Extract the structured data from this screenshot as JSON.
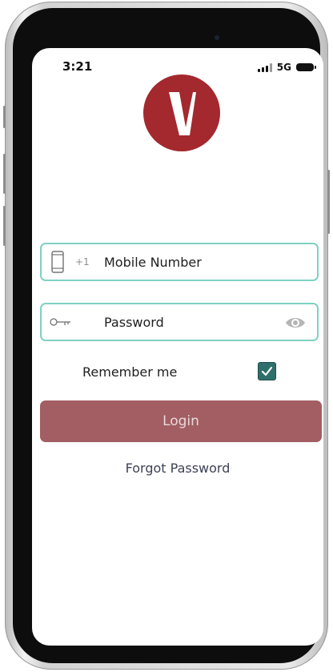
{
  "status_bar": {
    "time": "3:21",
    "network": "5G",
    "icons": [
      "signal-icon",
      "battery-icon"
    ]
  },
  "logo": {
    "icon": "brand-logo-icon",
    "colors": {
      "background": "#a3292e",
      "mark": "#ffffff"
    }
  },
  "login_form": {
    "mobile": {
      "icon": "phone-icon",
      "prefix": "+1",
      "placeholder": "Mobile Number",
      "value": ""
    },
    "password": {
      "icon": "key-icon",
      "placeholder": "Password",
      "value": "",
      "toggle_icon": "eye-icon"
    },
    "remember_me": {
      "label": "Remember me",
      "checked": true
    },
    "login_label": "Login",
    "forgot_password_label": "Forgot Password"
  },
  "colors": {
    "field_border": "#7fd1c2",
    "button": "#a25e63",
    "checkbox": "#2f6f6b",
    "link": "#3d4255"
  }
}
